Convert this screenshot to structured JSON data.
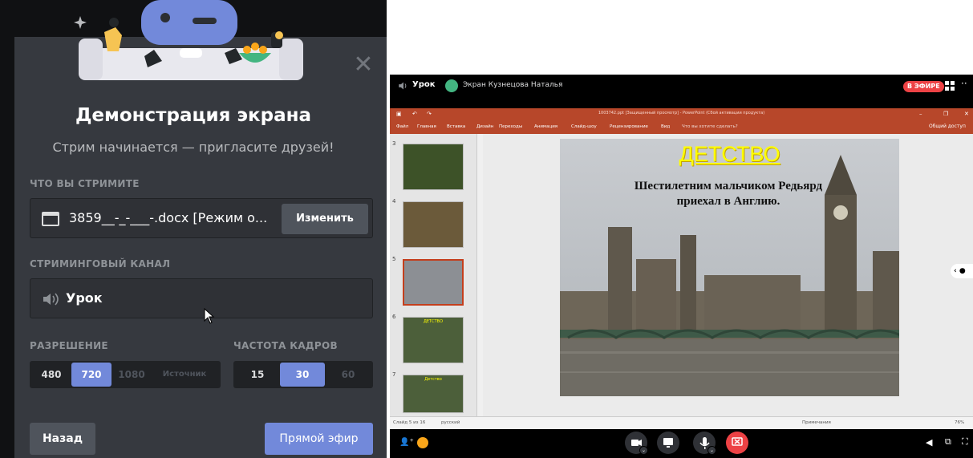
{
  "dialog": {
    "title": "Демонстрация экрана",
    "subtitle": "Стрим начинается — пригласите друзей!",
    "what_label": "ЧТО ВЫ СТРИМИТЕ",
    "file_name": "3859__-_-___-.docx [Режим о...",
    "change_label": "Изменить",
    "channel_label": "СТРИМИНГОВЫЙ КАНАЛ",
    "channel_name": "Урок",
    "resolution_label": "РАЗРЕШЕНИЕ",
    "resolution_options": [
      "480",
      "720",
      "1080",
      "Источник"
    ],
    "resolution_selected": "720",
    "fps_label": "ЧАСТОТА КАДРОВ",
    "fps_options": [
      "15",
      "30",
      "60"
    ],
    "fps_selected": "30",
    "back_label": "Назад",
    "live_label": "Прямой эфир",
    "accent": "#7289da"
  },
  "stream": {
    "channel": "Урок",
    "screen_label": "Экран Кузнецова Наталья",
    "live_badge": "В ЭФИРЕ",
    "powerpoint": {
      "window_title": "1003742.ppt [Защищенный просмотр] - PowerPoint (Сбой активации продукта)",
      "menu": [
        "Файл",
        "Главная",
        "Вставка",
        "Дизайн",
        "Переходы",
        "Анимация",
        "Слайд-шоу",
        "Рецензирование",
        "Вид",
        "Что вы хотите сделать?"
      ],
      "share": "Общий доступ",
      "thumb_numbers": [
        "3",
        "4",
        "5",
        "6",
        "7"
      ],
      "thumb_title_6": "ДЕТСТВО",
      "thumb_title_7": "Детство",
      "slide_title": "ДЕТСТВО",
      "slide_text_line1": "Шестилетним  мальчиком Редьярд",
      "slide_text_line2": "приехал в Англию.",
      "status_slide": "Слайд 5 из 16",
      "status_lang": "русский",
      "status_notes": "Примечания",
      "zoom": "76%"
    }
  }
}
